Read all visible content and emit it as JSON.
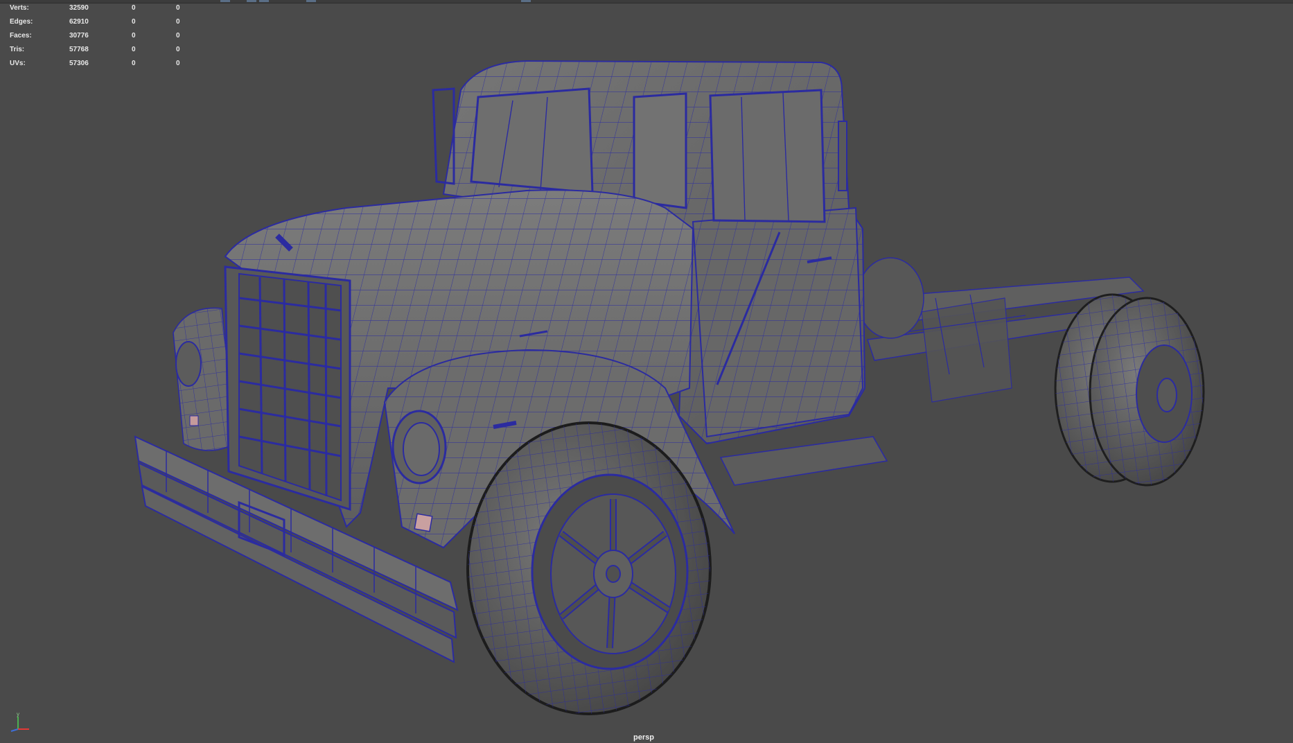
{
  "viewport": {
    "camera_label": "persp",
    "background_color": "#4a4a4a",
    "wire_color": "#2a2a9a",
    "surface_color": "#686868"
  },
  "hud": {
    "rows": [
      {
        "label": "Verts:",
        "v1": "32590",
        "v2": "0",
        "v3": "0"
      },
      {
        "label": "Edges:",
        "v1": "62910",
        "v2": "0",
        "v3": "0"
      },
      {
        "label": "Faces:",
        "v1": "30776",
        "v2": "0",
        "v3": "0"
      },
      {
        "label": "Tris:",
        "v1": "57768",
        "v2": "0",
        "v3": "0"
      },
      {
        "label": "UVs:",
        "v1": "57306",
        "v2": "0",
        "v3": "0"
      }
    ]
  },
  "axis_gizmo": {
    "y_label": "y",
    "icon": "axis-gizmo-icon"
  }
}
